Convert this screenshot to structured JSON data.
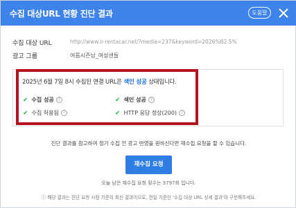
{
  "dialog": {
    "title": "수집 대상URL 현황 진단 결과",
    "help_label": "도움말",
    "close_icon": "close-icon"
  },
  "info": {
    "url_label": "수집 대상 URL",
    "url_value": "http://www.lr-rentacar.net/?media=237&keyword=2026%B2.5%",
    "group_label": "광고 그룹",
    "group_value": "여름시즌남_여성샌들"
  },
  "result": {
    "status_prefix": "2025년 6월 7일 8시 수집된 연결 URL은 ",
    "status_accent": "색인 성공",
    "status_suffix": " 상태입니다.",
    "checks": [
      {
        "label": "수집 성공",
        "bold": true
      },
      {
        "label": "색인 성공",
        "bold": true
      },
      {
        "label": "수집 허용됨",
        "bold": false
      },
      {
        "label": "HTTP 응답 정상(200)",
        "bold": false
      }
    ],
    "check_color": "#2db34a",
    "accent_color": "#1a6ee0"
  },
  "notice": "진단 결과를 참고하여 정기 수집 전 광고 반영을 원하신다면 재수집 요청을 할 수 있습니다.",
  "primary_button": "재수집 요청",
  "remaining": "오늘 남은 재수집 요청 횟수는 3797회 입니다.",
  "footnote": "ⓘ 해당 결과는 진단 요청 시점 기준의 최신 결과이므로, 전일 기준인 '수집 대상 URL 상세 결과'와 구분해주세요.",
  "colors": {
    "header": "#3d83ea",
    "highlight": "#b5141f",
    "primary": "#2f7ee6"
  }
}
